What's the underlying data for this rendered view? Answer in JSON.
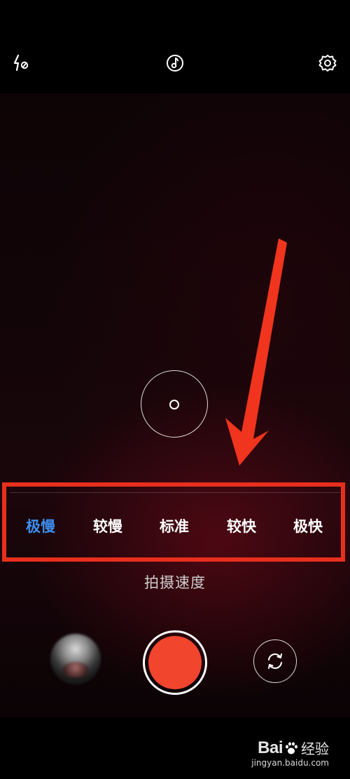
{
  "top_bar": {
    "flash_icon": "flash-off-icon",
    "music_icon": "music-note-icon",
    "settings_icon": "gear-icon"
  },
  "speed_selector": {
    "options": [
      "极慢",
      "较慢",
      "标准",
      "较快",
      "极快"
    ],
    "selected": "极慢",
    "title": "拍摄速度",
    "active_color": "#3d8eef",
    "highlight_color": "#e82f1d"
  },
  "controls": {
    "shutter_color": "#f2452e",
    "switch_camera_icon": "camera-switch-icon",
    "gallery_icon": "gallery-thumbnail"
  },
  "watermark": {
    "logo_text": "Bai",
    "logo_suffix": "经验",
    "url": "jingyan.baidu.com"
  }
}
